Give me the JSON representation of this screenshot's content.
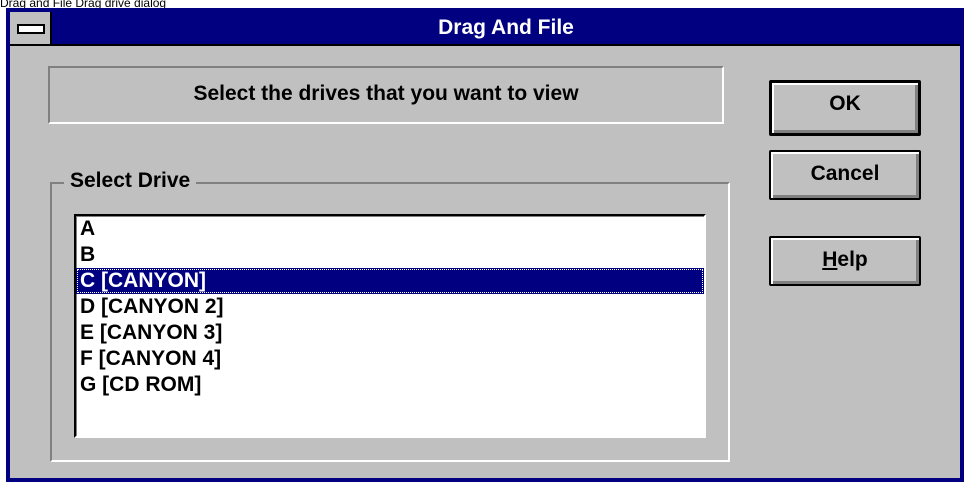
{
  "caption": "Drag and File Drag drive dialog",
  "window": {
    "title": "Drag And File",
    "system_menu_icon": "system-menu-icon"
  },
  "prompt": "Select the drives that you want to view",
  "group": {
    "label": "Select Drive",
    "drives": [
      {
        "label": "A",
        "selected": false
      },
      {
        "label": "B",
        "selected": false
      },
      {
        "label": "C [CANYON]",
        "selected": true
      },
      {
        "label": "D [CANYON 2]",
        "selected": false
      },
      {
        "label": "E [CANYON 3]",
        "selected": false
      },
      {
        "label": "F [CANYON 4]",
        "selected": false
      },
      {
        "label": "G [CD ROM]",
        "selected": false
      }
    ]
  },
  "buttons": {
    "ok": "OK",
    "cancel": "Cancel",
    "help_mnemonic": "H",
    "help_rest": "elp"
  },
  "colors": {
    "title_bar": "#000080",
    "face": "#c0c0c0",
    "selection": "#000080"
  }
}
